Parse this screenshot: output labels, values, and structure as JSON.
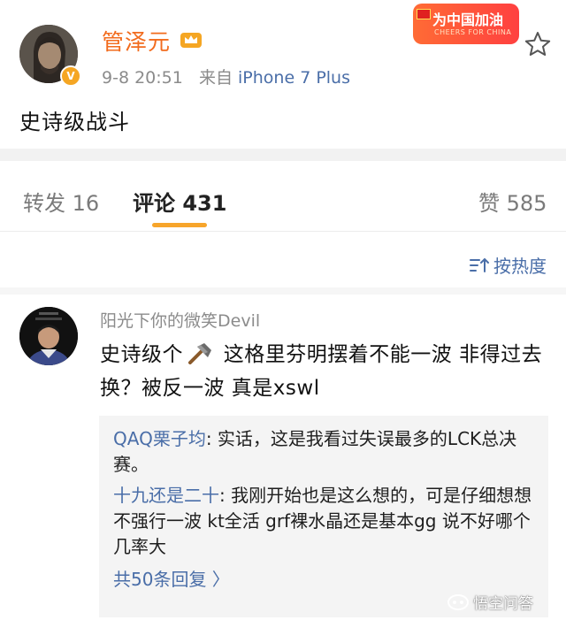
{
  "post": {
    "author": "管泽元",
    "time": "9-8 20:51",
    "source_prefix": "来自",
    "device": "iPhone 7 Plus",
    "content": "史诗级战斗",
    "verified_badge": "V",
    "promo_main": "为中国加油",
    "promo_sub": "CHEERS FOR CHINA"
  },
  "tabs": {
    "forward_label": "转发",
    "forward_count": "16",
    "comment_label": "评论",
    "comment_count": "431",
    "like_label": "赞",
    "like_count": "585"
  },
  "sort": {
    "label": "按热度"
  },
  "comment": {
    "user": "阳光下你的微笑Devil",
    "text_before_icon": "史诗级个",
    "text_after_icon": " 这格里芬明摆着不能一波 非得过去换？被反一波 真是xswl",
    "icon": "hammer-icon"
  },
  "replies": [
    {
      "user": "QAQ栗子均",
      "text": ": 实话，这是我看过失误最多的LCK总决赛。"
    },
    {
      "user": "十九还是二十",
      "text": ": 我刚开始也是这么想的，可是仔细想想 不强行一波 kt全活 grf裸水晶还是基本gg 说不好哪个几率大"
    }
  ],
  "more_replies": "共50条回复 〉",
  "watermark": "悟空问答",
  "colors": {
    "author": "#f26b1d",
    "link": "#4a6ea8",
    "tab_underline": "#f7a52b"
  }
}
